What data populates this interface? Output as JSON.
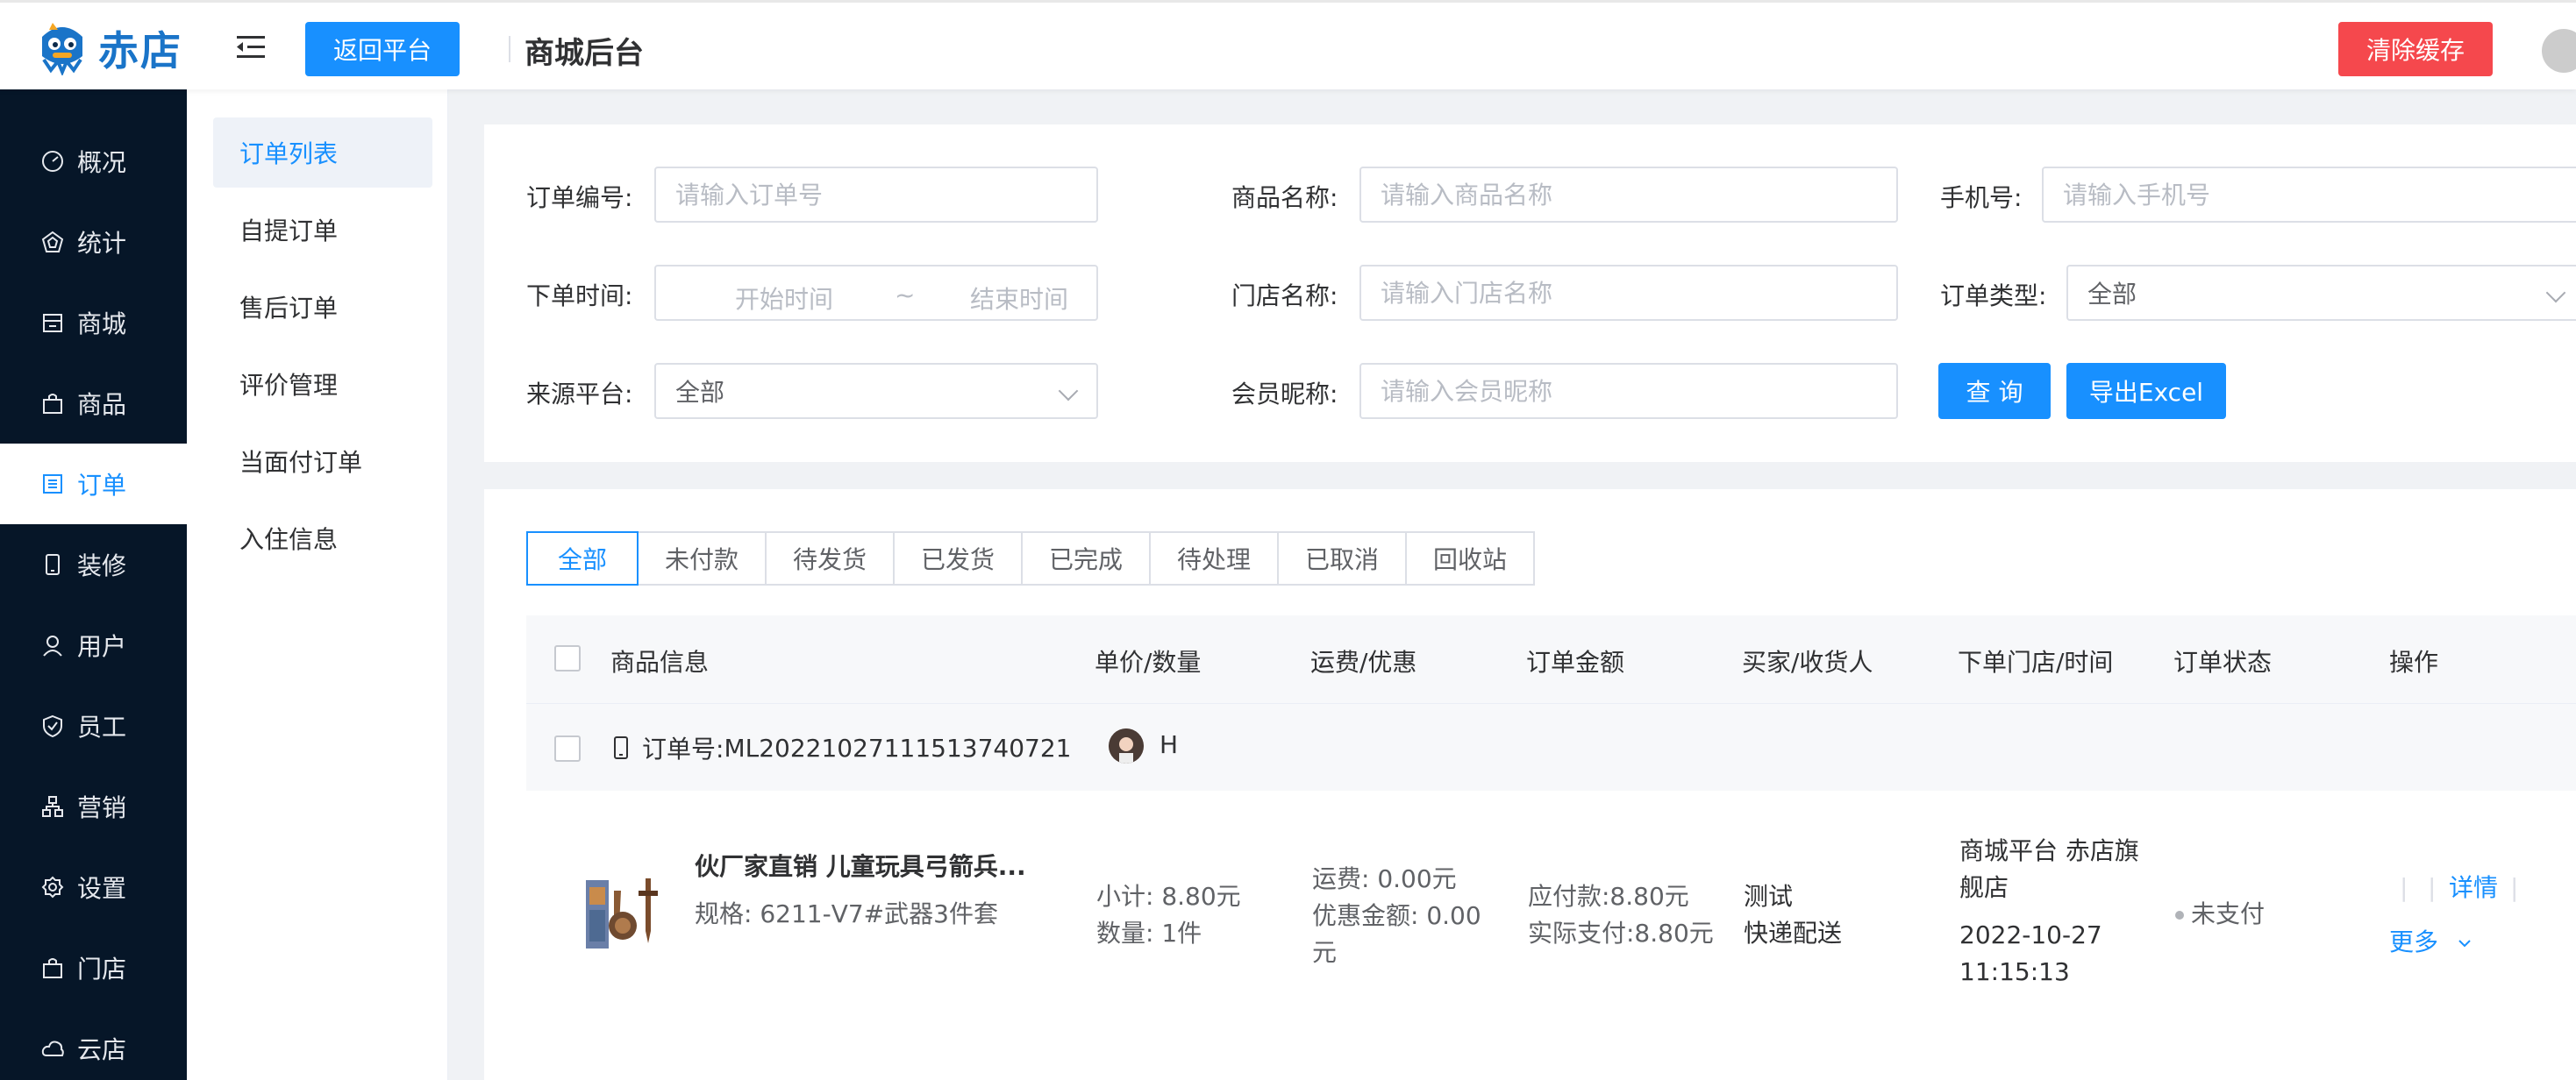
{
  "header": {
    "logo_text": "赤店",
    "back_button": "返回平台",
    "title": "商城后台",
    "clear_cache_button": "清除缓存"
  },
  "sidebar": {
    "items": [
      {
        "label": "概况",
        "icon": "dashboard-icon"
      },
      {
        "label": "统计",
        "icon": "stats-icon"
      },
      {
        "label": "商城",
        "icon": "shop-icon"
      },
      {
        "label": "商品",
        "icon": "bag-icon"
      },
      {
        "label": "订单",
        "icon": "order-icon",
        "active": true
      },
      {
        "label": "装修",
        "icon": "phone-icon"
      },
      {
        "label": "用户",
        "icon": "user-icon"
      },
      {
        "label": "员工",
        "icon": "shield-icon"
      },
      {
        "label": "营销",
        "icon": "marketing-icon"
      },
      {
        "label": "设置",
        "icon": "gear-icon"
      },
      {
        "label": "门店",
        "icon": "store-icon"
      },
      {
        "label": "云店",
        "icon": "cloud-icon"
      }
    ]
  },
  "submenu": {
    "items": [
      "订单列表",
      "自提订单",
      "售后订单",
      "评价管理",
      "当面付订单",
      "入住信息"
    ],
    "active_index": 0
  },
  "filters": {
    "order_no": {
      "label": "订单编号:",
      "placeholder": "请输入订单号"
    },
    "product_name": {
      "label": "商品名称:",
      "placeholder": "请输入商品名称"
    },
    "phone": {
      "label": "手机号:",
      "placeholder": "请输入手机号"
    },
    "order_time": {
      "label": "下单时间:",
      "start_placeholder": "开始时间",
      "separator": "~",
      "end_placeholder": "结束时间"
    },
    "store_name": {
      "label": "门店名称:",
      "placeholder": "请输入门店名称"
    },
    "order_type": {
      "label": "订单类型:",
      "value": "全部"
    },
    "source_platform": {
      "label": "来源平台:",
      "value": "全部"
    },
    "member_nick": {
      "label": "会员昵称:",
      "placeholder": "请输入会员昵称"
    },
    "query_button": "查 询",
    "export_button": "导出Excel"
  },
  "tabs": [
    "全部",
    "未付款",
    "待发货",
    "已发货",
    "已完成",
    "待处理",
    "已取消",
    "回收站"
  ],
  "table": {
    "headers": [
      "商品信息",
      "单价/数量",
      "运费/优惠",
      "订单金额",
      "买家/收货人",
      "下单门店/时间",
      "订单状态",
      "操作"
    ]
  },
  "order": {
    "order_no_label": "订单号:",
    "order_no": "ML20221027111513740721",
    "buyer_initial": "H",
    "product_title": "伙厂家直销 儿童玩具弓箭兵...",
    "product_spec": "规格:  6211-V7#武器3件套",
    "subtotal": "小计:  8.80元",
    "quantity": "数量:  1件",
    "shipping": "运费:  0.00元",
    "discount": "优惠金额:  0.00元",
    "payable": "应付款:8.80元",
    "paid": "实际支付:8.80元",
    "buyer": "测试",
    "delivery": "快递配送",
    "store": "商城平台 赤店旗舰店",
    "date": "2022-10-27",
    "time": "11:15:13",
    "status": "未支付",
    "action_detail": "详情",
    "action_more": "更多"
  }
}
